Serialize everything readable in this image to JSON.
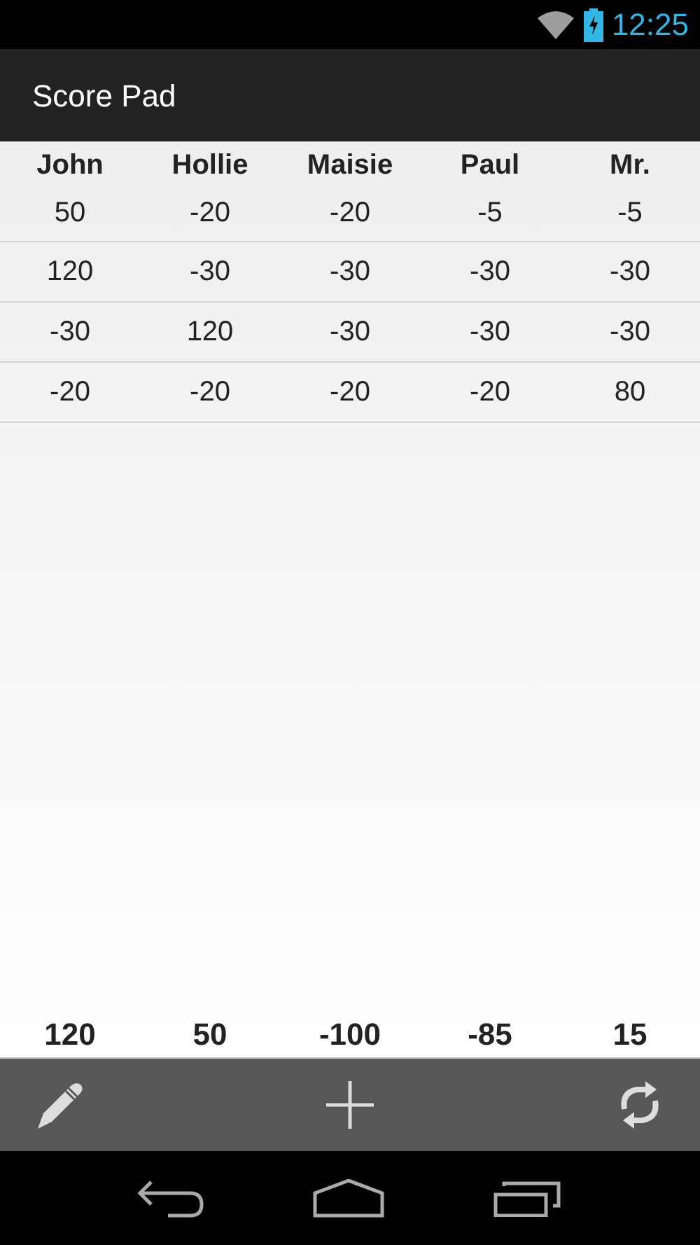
{
  "status_bar": {
    "time": "12:25"
  },
  "app_bar": {
    "title": "Score Pad"
  },
  "table": {
    "columns": [
      "John",
      "Hollie",
      "Maisie",
      "Paul",
      "Mr."
    ],
    "rows": [
      [
        "50",
        "-20",
        "-20",
        "-5",
        "-5"
      ],
      [
        "120",
        "-30",
        "-30",
        "-30",
        "-30"
      ],
      [
        "-30",
        "120",
        "-30",
        "-30",
        "-30"
      ],
      [
        "-20",
        "-20",
        "-20",
        "-20",
        "80"
      ]
    ],
    "totals": [
      "120",
      "50",
      "-100",
      "-85",
      "15"
    ]
  }
}
